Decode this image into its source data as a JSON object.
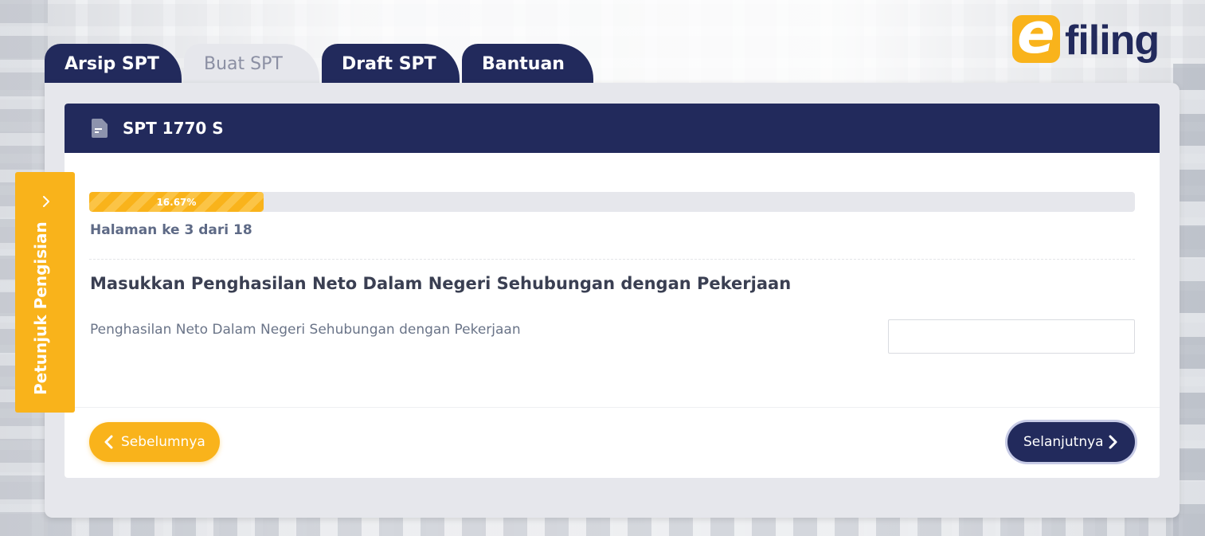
{
  "app": {
    "logo_text": "filing",
    "logo_mark": "e"
  },
  "tabs": [
    {
      "label": "Arsip SPT",
      "active": false
    },
    {
      "label": "Buat SPT",
      "active": true
    },
    {
      "label": "Draft SPT",
      "active": false
    },
    {
      "label": "Bantuan",
      "active": false
    }
  ],
  "card": {
    "icon": "document-icon",
    "title": "SPT 1770 S"
  },
  "progress": {
    "percent": 16.67,
    "label": "16.67%",
    "page_info": "Halaman ke 3 dari 18"
  },
  "form": {
    "section_title": "Masukkan Penghasilan Neto Dalam Negeri Sehubungan dengan Pekerjaan",
    "field_label": "Penghasilan Neto Dalam Negeri Sehubungan dengan Pekerjaan",
    "field_value": ""
  },
  "nav": {
    "prev_label": "Sebelumnya",
    "next_label": "Selanjutnya"
  },
  "side_panel": {
    "label": "Petunjuk Pengisian",
    "icon": "chevron-right-icon"
  },
  "colors": {
    "navy": "#222a5c",
    "accent": "#f9b31b",
    "panel": "#e6e7ec"
  }
}
